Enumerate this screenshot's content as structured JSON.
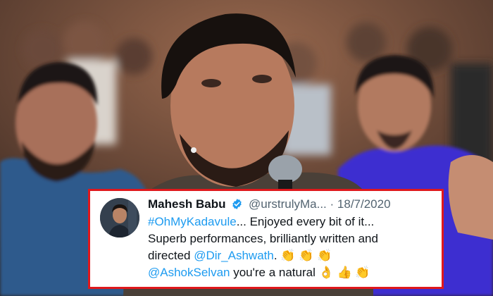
{
  "tweet": {
    "display_name": "Mahesh Babu",
    "handle": "@urstrulyMa...",
    "separator": "·",
    "date": "18/7/2020",
    "line1_tag": "#OhMyKadavule",
    "line1_rest": "... Enjoyed every bit of it...",
    "line2": "Superb performances, brilliantly written and",
    "line3_pre": "directed ",
    "line3_mention": "@Dir_Ashwath",
    "line3_post": ".",
    "line3_emoji": "👏 👏 👏",
    "line4_mention": "@AshokSelvan",
    "line4_rest": " you're a natural ",
    "line4_emoji": "👌 👍 👏"
  },
  "colors": {
    "border": "#e0181c",
    "link": "#1d9bf0",
    "verified": "#1d9bf0",
    "muted": "#536471",
    "text": "#0f1419"
  },
  "icons": [
    "verified-badge-icon",
    "avatar-photo"
  ]
}
